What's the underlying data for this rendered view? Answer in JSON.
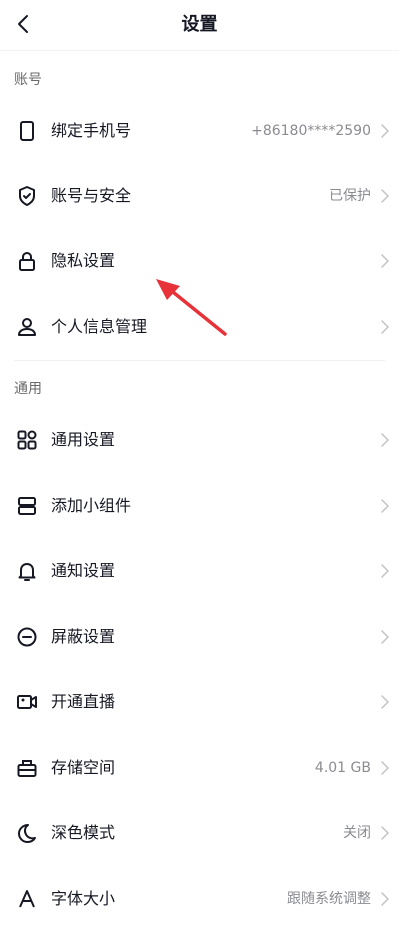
{
  "header": {
    "title": "设置"
  },
  "sections": [
    {
      "title": "账号"
    },
    {
      "title": "通用"
    }
  ],
  "rows": [
    {
      "label": "绑定手机号",
      "value": "+86180****2590",
      "icon": "phone-icon"
    },
    {
      "label": "账号与安全",
      "value": "已保护",
      "icon": "shield-check-icon"
    },
    {
      "label": "隐私设置",
      "value": "",
      "icon": "lock-icon"
    },
    {
      "label": "个人信息管理",
      "value": "",
      "icon": "person-icon"
    },
    {
      "label": "通用设置",
      "value": "",
      "icon": "grid-icon"
    },
    {
      "label": "添加小组件",
      "value": "",
      "icon": "widget-icon"
    },
    {
      "label": "通知设置",
      "value": "",
      "icon": "bell-icon"
    },
    {
      "label": "屏蔽设置",
      "value": "",
      "icon": "block-icon"
    },
    {
      "label": "开通直播",
      "value": "",
      "icon": "live-camera-icon"
    },
    {
      "label": "存储空间",
      "value": "4.01 GB",
      "icon": "storage-icon"
    },
    {
      "label": "深色模式",
      "value": "关闭",
      "icon": "moon-icon"
    },
    {
      "label": "字体大小",
      "value": "跟随系统调整",
      "icon": "font-size-icon"
    }
  ],
  "colors": {
    "annotation_arrow": "#e8323a",
    "text": "#161823",
    "secondary": "#8a8b91"
  }
}
